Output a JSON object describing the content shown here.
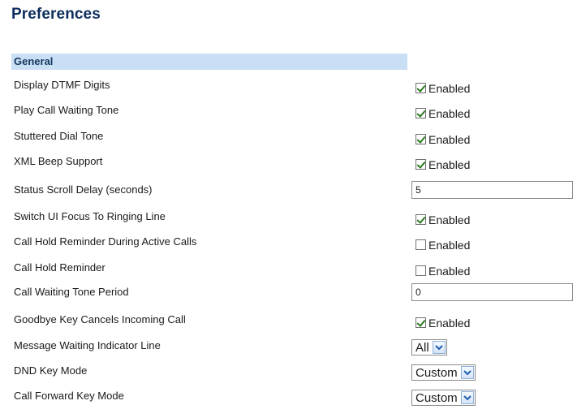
{
  "page": {
    "title": "Preferences"
  },
  "section": {
    "title": "General"
  },
  "rows": [
    {
      "label": "Display DTMF Digits",
      "type": "checkbox",
      "checked": true,
      "value_label": "Enabled"
    },
    {
      "label": "Play Call Waiting Tone",
      "type": "checkbox",
      "checked": true,
      "value_label": "Enabled"
    },
    {
      "label": "Stuttered Dial Tone",
      "type": "checkbox",
      "checked": true,
      "value_label": "Enabled"
    },
    {
      "label": "XML Beep Support",
      "type": "checkbox",
      "checked": true,
      "value_label": "Enabled"
    },
    {
      "label": "Status Scroll Delay (seconds)",
      "type": "text",
      "value": "5"
    },
    {
      "label": "Switch UI Focus To Ringing Line",
      "type": "checkbox",
      "checked": true,
      "value_label": "Enabled"
    },
    {
      "label": "Call Hold Reminder During Active Calls",
      "type": "checkbox",
      "checked": false,
      "value_label": "Enabled"
    },
    {
      "label": "Call Hold Reminder",
      "type": "checkbox",
      "checked": false,
      "value_label": "Enabled"
    },
    {
      "label": "Call Waiting Tone Period",
      "type": "text",
      "value": "0"
    },
    {
      "label": "Goodbye Key Cancels Incoming Call",
      "type": "checkbox",
      "checked": true,
      "value_label": "Enabled"
    },
    {
      "label": "Message Waiting Indicator Line",
      "type": "select",
      "value": "All"
    },
    {
      "label": "DND Key Mode",
      "type": "select",
      "value": "Custom"
    },
    {
      "label": "Call Forward Key Mode",
      "type": "select",
      "value": "Custom"
    }
  ],
  "colors": {
    "title": "#0d2d5e",
    "section_header_bg": "#c9dff5",
    "checkmark": "#2b7a1f",
    "dropdown_arrow": "#1f5fae"
  },
  "icons": {
    "checkbox": "checkbox-icon",
    "dropdown": "chevron-down-icon"
  }
}
